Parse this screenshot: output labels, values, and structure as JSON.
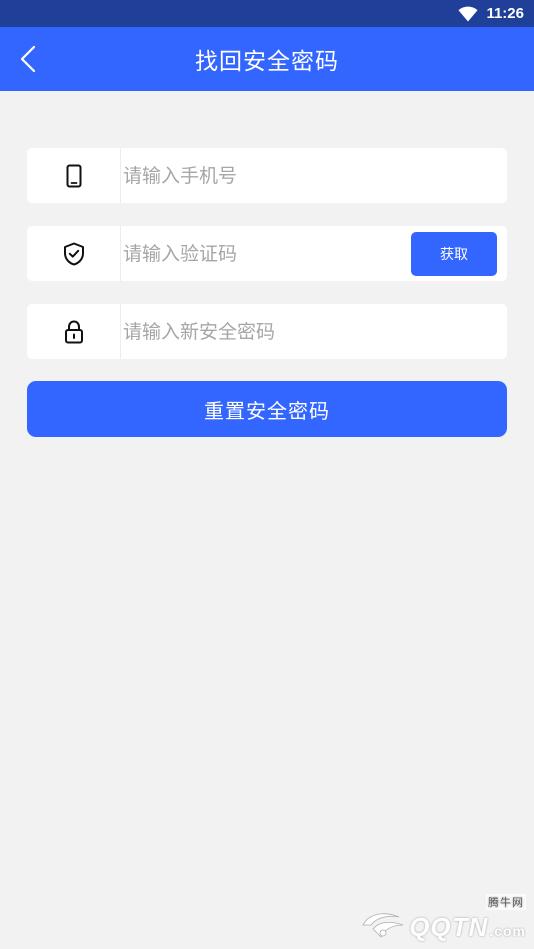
{
  "status_bar": {
    "time": "11:26",
    "icons": [
      "wifi-icon"
    ],
    "background": "#1f3f99"
  },
  "app_bar": {
    "title": "找回安全密码",
    "back_icon": "chevron-left-icon",
    "background": "#3366ff"
  },
  "form": {
    "phone": {
      "icon": "smartphone-icon",
      "value": "",
      "placeholder": "请输入手机号"
    },
    "code": {
      "icon": "shield-check-icon",
      "value": "",
      "placeholder": "请输入验证码",
      "get_button_label": "获取"
    },
    "new_password": {
      "icon": "lock-icon",
      "value": "",
      "placeholder": "请输入新安全密码"
    },
    "submit_label": "重置安全密码"
  },
  "watermark": {
    "brand": "QQTN",
    "domain_suffix": ".com",
    "cn_name": "腾牛网"
  },
  "colors": {
    "primary": "#3366ff",
    "page_background": "#f2f2f2",
    "field_background": "#ffffff",
    "placeholder": "#a6a6a6"
  }
}
